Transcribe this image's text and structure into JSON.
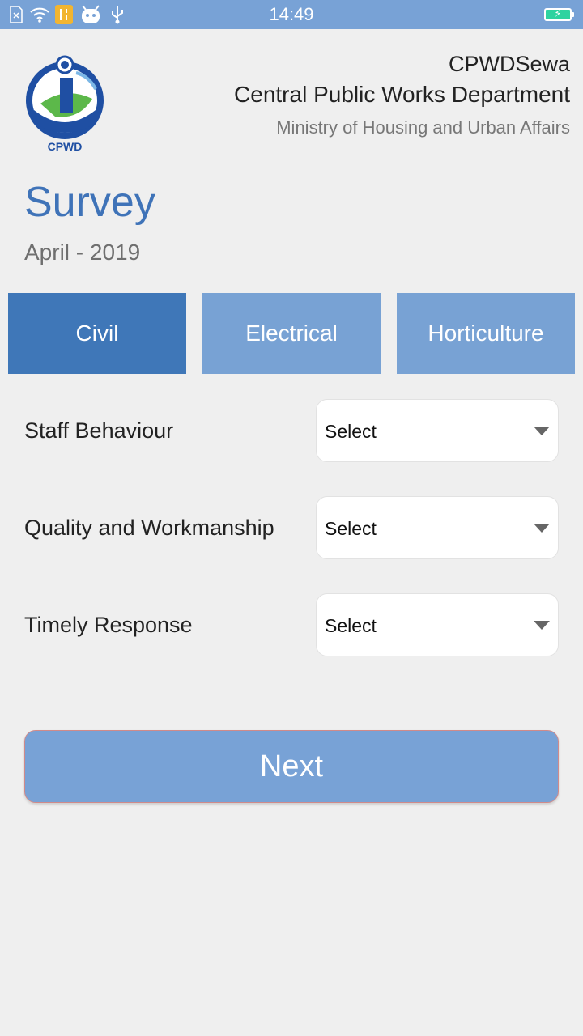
{
  "status_bar": {
    "time": "14:49",
    "icons": [
      "sim-absent-icon",
      "wifi-icon",
      "tools-notification-icon",
      "android-icon",
      "usb-icon",
      "battery-charging-icon"
    ]
  },
  "header": {
    "logo_text": "CPWD",
    "app_name": "CPWDSewa",
    "department": "Central Public Works Department",
    "ministry": "Ministry of Housing and Urban Affairs"
  },
  "survey": {
    "title": "Survey",
    "date": "April - 2019"
  },
  "tabs": [
    {
      "label": "Civil",
      "active": true
    },
    {
      "label": "Electrical",
      "active": false
    },
    {
      "label": "Horticulture",
      "active": false
    }
  ],
  "questions": [
    {
      "label": "Staff Behaviour",
      "value": "Select"
    },
    {
      "label": "Quality and Workmanship",
      "value": "Select"
    },
    {
      "label": "Timely Response",
      "value": "Select"
    }
  ],
  "next_button": {
    "label": "Next"
  },
  "colors": {
    "primary": "#3f77b8",
    "tab_inactive": "#78a2d4",
    "status_bar": "#78a2d6",
    "background": "#efefef"
  }
}
